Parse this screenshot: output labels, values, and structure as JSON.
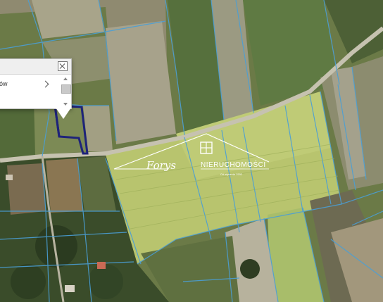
{
  "map": {
    "popup": {
      "row_label": "ów"
    },
    "watermark": {
      "brand": "NIERUCHOMOŚCI",
      "script_name": "Forys",
      "tagline": "Od stycznia 1992"
    },
    "colors": {
      "parcel_boundary": "#4a9fd6",
      "selected_parcel": "#1e237a",
      "field_light": "#b9c86f",
      "road": "#c6c2b0"
    },
    "icons": [
      "close-icon",
      "chevron-right-icon",
      "scroll-up-icon",
      "scroll-down-icon",
      "house-window-icon"
    ]
  }
}
